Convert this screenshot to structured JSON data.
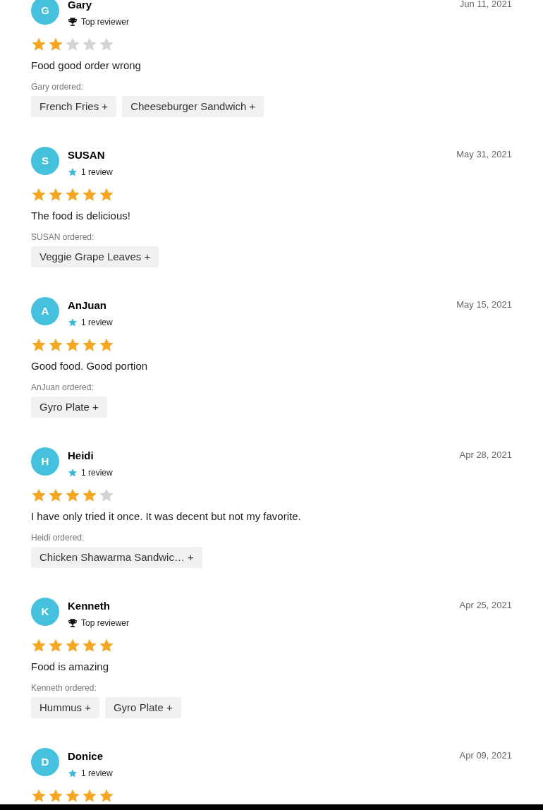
{
  "reviews": [
    {
      "initial": "G",
      "name": "Gary",
      "badge": {
        "kind": "top_reviewer",
        "label": "Top reviewer"
      },
      "date": "Jun 11, 2021",
      "stars": 2,
      "text": "Food good order wrong",
      "ordered_label": "Gary ordered:",
      "items": [
        "French Fries",
        "Cheeseburger Sandwich"
      ]
    },
    {
      "initial": "S",
      "name": "SUSAN",
      "badge": {
        "kind": "review_count",
        "label": "1 review"
      },
      "date": "May 31, 2021",
      "stars": 5,
      "text": "The food is delicious!",
      "ordered_label": "SUSAN ordered:",
      "items": [
        "Veggie Grape Leaves"
      ]
    },
    {
      "initial": "A",
      "name": "AnJuan",
      "badge": {
        "kind": "review_count",
        "label": "1 review"
      },
      "date": "May 15, 2021",
      "stars": 5,
      "text": "Good food. Good portion",
      "ordered_label": "AnJuan ordered:",
      "items": [
        "Gyro Plate"
      ]
    },
    {
      "initial": "H",
      "name": "Heidi",
      "badge": {
        "kind": "review_count",
        "label": "1 review"
      },
      "date": "Apr 28, 2021",
      "stars": 4,
      "text": "I have only tried it once. It was decent but not my favorite.",
      "ordered_label": "Heidi ordered:",
      "items": [
        "Chicken Shawarma Sandwic…"
      ]
    },
    {
      "initial": "K",
      "name": "Kenneth",
      "badge": {
        "kind": "top_reviewer",
        "label": "Top reviewer"
      },
      "date": "Apr 25, 2021",
      "stars": 5,
      "text": "Food is amazing",
      "ordered_label": "Kenneth ordered:",
      "items": [
        "Hummus",
        "Gyro Plate"
      ]
    },
    {
      "initial": "D",
      "name": "Donice",
      "badge": {
        "kind": "review_count",
        "label": "1 review"
      },
      "date": "Apr 09, 2021",
      "stars": 5
    }
  ],
  "plus_sign": "+"
}
